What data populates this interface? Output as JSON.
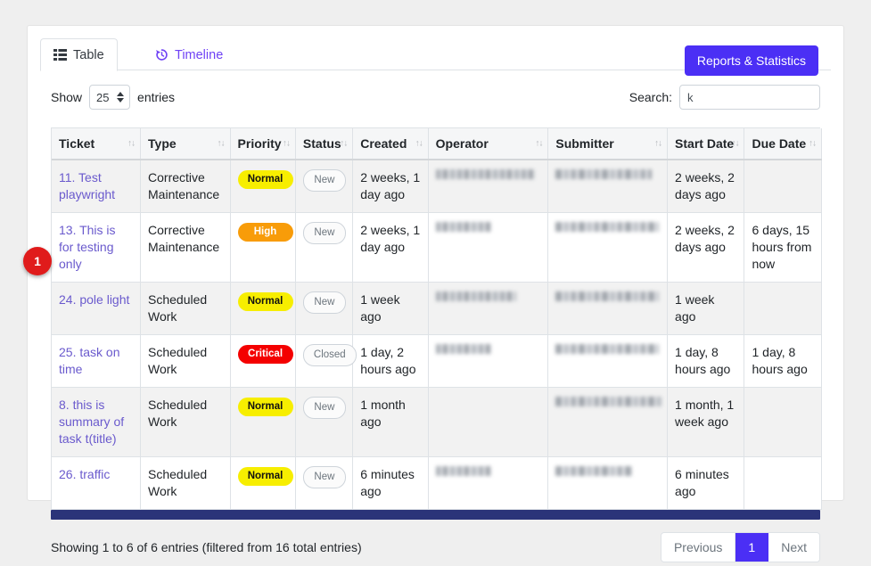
{
  "colors": {
    "accent": "#4b2ff5",
    "link": "#6a5acd",
    "scrollbar": "#2b3479",
    "badge": "#e01b1b",
    "priority_normal": "#f7ee00",
    "priority_high": "#f89c09",
    "priority_critical": "#f40000"
  },
  "tabs": [
    {
      "label": "Table",
      "icon": "table-icon",
      "active": true
    },
    {
      "label": "Timeline",
      "icon": "history-clock-icon",
      "active": false
    }
  ],
  "toolbar": {
    "reports_label": "Reports & Statistics"
  },
  "controls": {
    "show_label": "Show",
    "entries_label": "entries",
    "page_length": "25",
    "search_label": "Search:",
    "search_value": "k",
    "search_placeholder": ""
  },
  "table": {
    "columns": [
      "Ticket",
      "Type",
      "Priority",
      "Status",
      "Created",
      "Operator",
      "Submitter",
      "Start Date",
      "Due Date"
    ],
    "rows": [
      {
        "ticket": "11. Test playwright",
        "type": "Corrective Maintenance",
        "priority": "Normal",
        "priority_class": "pill-normal",
        "status": "New",
        "created": "2 weeks, 1 day ago",
        "operator": "[redacted]",
        "submitter": "[redacted]",
        "start_date": "2 weeks, 2 days ago",
        "due_date": ""
      },
      {
        "ticket": "13. This is for testing only",
        "type": "Corrective Maintenance",
        "priority": "High",
        "priority_class": "pill-high",
        "status": "New",
        "created": "2 weeks, 1 day ago",
        "operator": "[redacted]",
        "submitter": "[redacted]",
        "start_date": "2 weeks, 2 days ago",
        "due_date": "6 days, 15 hours from now"
      },
      {
        "ticket": "24. pole light",
        "type": "Scheduled Work",
        "priority": "Normal",
        "priority_class": "pill-normal",
        "status": "New",
        "created": "1 week ago",
        "operator": "[redacted]",
        "submitter": "[redacted]",
        "start_date": "1 week ago",
        "due_date": ""
      },
      {
        "ticket": "25. task on time",
        "type": "Scheduled Work",
        "priority": "Critical",
        "priority_class": "pill-critical",
        "status": "Closed",
        "created": "1 day, 2 hours ago",
        "operator": "[redacted]",
        "submitter": "[redacted]",
        "start_date": "1 day, 8 hours ago",
        "due_date": "1 day, 8 hours ago"
      },
      {
        "ticket": "8. this is summary of task t(title)",
        "type": "Scheduled Work",
        "priority": "Normal",
        "priority_class": "pill-normal",
        "status": "New",
        "created": "1 month ago",
        "operator": "",
        "submitter": "[redacted]",
        "start_date": "1 month, 1 week ago",
        "due_date": ""
      },
      {
        "ticket": "26. traffic",
        "type": "Scheduled Work",
        "priority": "Normal",
        "priority_class": "pill-normal",
        "status": "New",
        "created": "6 minutes ago",
        "operator": "[redacted]",
        "submitter": "[redacted]",
        "start_date": "6 minutes ago",
        "due_date": ""
      }
    ]
  },
  "footer": {
    "info": "Showing 1 to 6 of 6 entries (filtered from 16 total entries)",
    "previous_label": "Previous",
    "page_label": "1",
    "next_label": "Next"
  },
  "annotation": {
    "marker_label": "1"
  }
}
